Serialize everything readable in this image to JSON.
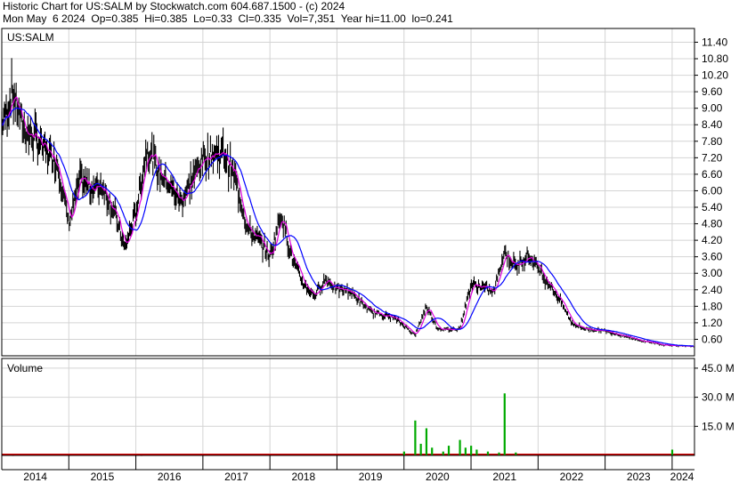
{
  "header": {
    "line1": "Historic Chart for US:SALM by Stockwatch.com 604.687.1500 - (c) 2024",
    "line2": "Mon May  6 2024  Op=0.385  Hi=0.385  Lo=0.33  Cl=0.335  Vol=7,351  Year hi=11.00  lo=0.241"
  },
  "price_panel": {
    "label": "US:SALM"
  },
  "volume_panel": {
    "label": "Volume"
  },
  "colors": {
    "price_bars": "#000000",
    "short_ma": "#e000e0",
    "long_ma": "#0000ff",
    "vol_red": "#cc0000",
    "vol_green": "#00aa00",
    "grid": "#d4d4d4"
  },
  "chart_data": [
    {
      "type": "line",
      "title": "",
      "series": [
        {
          "values": [
            [
              "2014-01",
              8.4
            ],
            [
              "2014-03",
              9.6
            ],
            [
              "2014-05",
              8.2
            ],
            [
              "2014-07",
              7.9
            ],
            [
              "2014-09",
              7.4
            ],
            [
              "2014-11",
              7.0
            ],
            [
              "2015-01",
              4.8
            ],
            [
              "2015-03",
              6.4
            ],
            [
              "2015-05",
              6.1
            ],
            [
              "2015-07",
              6.2
            ],
            [
              "2015-09",
              5.3
            ],
            [
              "2015-11",
              3.9
            ],
            [
              "2016-01",
              5.2
            ],
            [
              "2016-03",
              7.6
            ],
            [
              "2016-05",
              6.7
            ],
            [
              "2016-07",
              6.2
            ],
            [
              "2016-09",
              5.6
            ],
            [
              "2016-11",
              6.4
            ],
            [
              "2017-01",
              7.2
            ],
            [
              "2017-03",
              7.4
            ],
            [
              "2017-05",
              7.3
            ],
            [
              "2017-07",
              6.3
            ],
            [
              "2017-09",
              4.6
            ],
            [
              "2017-11",
              4.2
            ],
            [
              "2018-01",
              3.6
            ],
            [
              "2018-03",
              5.2
            ],
            [
              "2018-05",
              3.5
            ],
            [
              "2018-07",
              2.6
            ],
            [
              "2018-09",
              2.2
            ],
            [
              "2018-11",
              2.8
            ],
            [
              "2019-01",
              2.4
            ],
            [
              "2019-03",
              2.4
            ],
            [
              "2019-05",
              2.0
            ],
            [
              "2019-07",
              1.6
            ],
            [
              "2019-09",
              1.5
            ],
            [
              "2019-11",
              1.4
            ],
            [
              "2020-01",
              1.1
            ],
            [
              "2020-03",
              0.75
            ],
            [
              "2020-05",
              1.8
            ],
            [
              "2020-07",
              1.0
            ],
            [
              "2020-09",
              0.95
            ],
            [
              "2020-11",
              1.0
            ],
            [
              "2021-01",
              2.6
            ],
            [
              "2021-03",
              2.5
            ],
            [
              "2021-05",
              2.3
            ],
            [
              "2021-07",
              3.8
            ],
            [
              "2021-09",
              3.2
            ],
            [
              "2021-11",
              3.7
            ],
            [
              "2022-01",
              3.2
            ],
            [
              "2022-03",
              2.6
            ],
            [
              "2022-05",
              2.0
            ],
            [
              "2022-07",
              1.2
            ],
            [
              "2022-09",
              1.0
            ],
            [
              "2022-11",
              0.95
            ],
            [
              "2023-01",
              0.9
            ],
            [
              "2023-03",
              0.8
            ],
            [
              "2023-05",
              0.7
            ],
            [
              "2023-07",
              0.55
            ],
            [
              "2023-09",
              0.5
            ],
            [
              "2023-11",
              0.4
            ],
            [
              "2024-01",
              0.38
            ],
            [
              "2024-03",
              0.35
            ],
            [
              "2024-05",
              0.335
            ]
          ]
        }
      ],
      "yticks": [
        "0.60",
        "1.20",
        "1.80",
        "2.40",
        "3.00",
        "3.60",
        "4.20",
        "4.80",
        "5.40",
        "6.00",
        "6.60",
        "7.20",
        "7.80",
        "8.40",
        "9.00",
        "9.60",
        "10.20",
        "10.80",
        "11.40"
      ],
      "ylim": [
        0,
        11.9
      ],
      "xticks": [
        "2014",
        "2015",
        "2016",
        "2017",
        "2018",
        "2019",
        "2020",
        "2021",
        "2022",
        "2023",
        "2024"
      ],
      "xlim": [
        "2014-01",
        "2024-05"
      ],
      "grid": true
    },
    {
      "type": "bar",
      "title": "",
      "series": [
        {
          "values": [
            [
              "2014-03",
              0.2
            ],
            [
              "2015-01",
              0.2
            ],
            [
              "2016-02",
              0.2
            ],
            [
              "2017-01",
              0.3
            ],
            [
              "2018-03",
              0.4
            ],
            [
              "2019-02",
              0.3
            ],
            [
              "2019-11",
              0.4
            ],
            [
              "2020-01",
              2.0
            ],
            [
              "2020-03",
              18.0
            ],
            [
              "2020-04",
              6.0
            ],
            [
              "2020-05",
              14.0
            ],
            [
              "2020-06",
              4.0
            ],
            [
              "2020-08",
              2.0
            ],
            [
              "2020-09",
              5.0
            ],
            [
              "2020-11",
              8.0
            ],
            [
              "2020-12",
              4.0
            ],
            [
              "2021-01",
              5.0
            ],
            [
              "2021-02",
              3.0
            ],
            [
              "2021-04",
              2.0
            ],
            [
              "2021-06",
              1.5
            ],
            [
              "2021-07",
              32.0
            ],
            [
              "2021-09",
              1.5
            ],
            [
              "2022-03",
              0.8
            ],
            [
              "2022-09",
              0.5
            ],
            [
              "2023-05",
              0.6
            ],
            [
              "2024-01",
              3.0
            ]
          ]
        }
      ],
      "yticks": [
        "15.0 M",
        "30.0 M",
        "45.0 M"
      ],
      "ylim": [
        0,
        50
      ],
      "grid": true
    }
  ]
}
